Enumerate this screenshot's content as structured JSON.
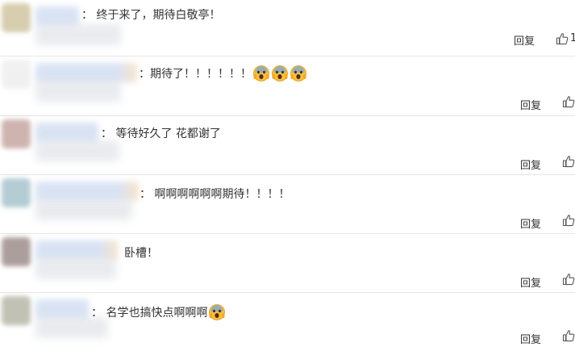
{
  "comments": [
    {
      "text": "： 终于来了，期待白敬亭！",
      "reply_label": "回复",
      "like_count": "1"
    },
    {
      "text": "：期待了！！！！！！",
      "reply_label": "回复"
    },
    {
      "text": "： 等待好久了 花都谢了",
      "reply_label": "回复"
    },
    {
      "text": "： 啊啊啊啊啊啊期待！！！！",
      "reply_label": "回复"
    },
    {
      "text": "卧槽！",
      "reply_label": "回复"
    },
    {
      "text": "： 名学也搞快点啊啊啊",
      "reply_label": "回复"
    }
  ],
  "icons": {
    "like": "thumbs-up-icon",
    "emoji": "screaming-face-emoji"
  }
}
